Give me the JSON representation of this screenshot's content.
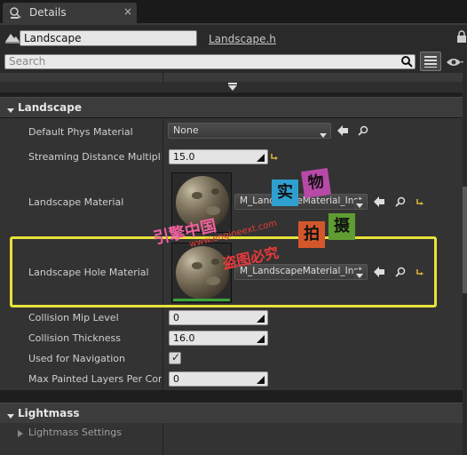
{
  "tab": {
    "title": "Details",
    "close": "×"
  },
  "header": {
    "actor_name": "Landscape",
    "class_link": "Landscape.h",
    "search_placeholder": "Search"
  },
  "categories": {
    "landscape": "Landscape",
    "lightmass": "Lightmass"
  },
  "properties": {
    "default_phys_material": {
      "label": "Default Phys Material",
      "value": "None"
    },
    "streaming_distance": {
      "label": "Streaming Distance Multiplier",
      "value": "15.0"
    },
    "landscape_material": {
      "label": "Landscape Material",
      "value": "M_LandscapeMaterial_Inst"
    },
    "landscape_hole_material": {
      "label": "Landscape Hole Material",
      "value": "M_LandscapeMaterial_Inst"
    },
    "collision_mip_level": {
      "label": "Collision Mip Level",
      "value": "0"
    },
    "collision_thickness": {
      "label": "Collision Thickness",
      "value": "16.0"
    },
    "used_for_navigation": {
      "label": "Used for Navigation",
      "checked": true,
      "check_glyph": "✓"
    },
    "max_painted_layers": {
      "label": "Max Painted Layers Per Comp",
      "value": "0"
    }
  },
  "lightmass": {
    "settings_label": "Lightmass Settings"
  },
  "watermark": {
    "shi": "实",
    "wu": "物",
    "pai": "拍",
    "she": "摄",
    "yinqing": "引擎中国",
    "site": "www.engineext.com",
    "piracy": "盗图必究"
  },
  "colors": {
    "highlight": "#e8e23a",
    "accent_green": "#3aa33a",
    "reset_arrow": "#d6b33a"
  }
}
